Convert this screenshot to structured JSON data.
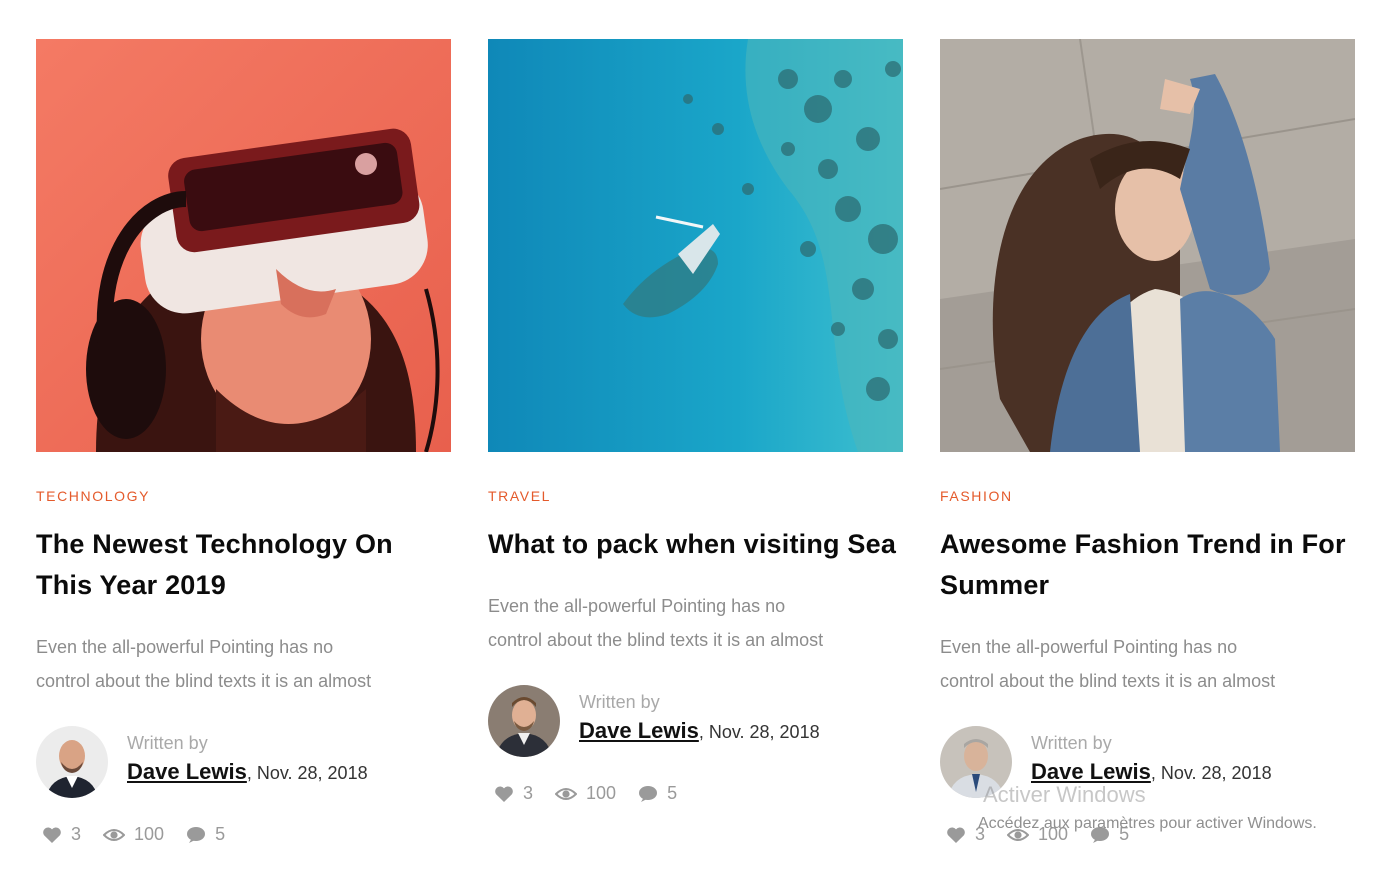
{
  "posts": [
    {
      "category": "TECHNOLOGY",
      "title": "The Newest Technology On This Year 2019",
      "excerpt_line1": "Even the all-powerful Pointing has no",
      "excerpt_line2": "control about the blind texts it is an almost",
      "written_by": "Written by",
      "author": "Dave Lewis",
      "date": ", Nov. 28, 2018",
      "likes": "3",
      "views": "100",
      "comments": "5",
      "image": "vr-headset-photo"
    },
    {
      "category": "TRAVEL",
      "title": "What to pack when visiting Sea",
      "excerpt_line1": "Even the all-powerful Pointing has no",
      "excerpt_line2": "control about the blind texts it is an almost",
      "written_by": "Written by",
      "author": "Dave Lewis",
      "date": ", Nov. 28, 2018",
      "likes": "3",
      "views": "100",
      "comments": "5",
      "image": "shipwreck-aerial-photo"
    },
    {
      "category": "FASHION",
      "title": "Awesome Fashion Trend in For Summer",
      "excerpt_line1": "Even the all-powerful Pointing has no",
      "excerpt_line2": "control about the blind texts it is an almost",
      "written_by": "Written by",
      "author": "Dave Lewis",
      "date": ", Nov. 28, 2018",
      "likes": "3",
      "views": "100",
      "comments": "5",
      "image": "denim-jacket-woman-photo"
    }
  ],
  "windows_watermark": {
    "title": "Activer Windows",
    "subtitle": "Accédez aux paramètres pour activer Windows."
  },
  "colors": {
    "category": "#e45a2b",
    "title": "#0b0b0b",
    "excerpt": "#8c8c8c",
    "icon": "#9a9a9a"
  },
  "icons": [
    "heart-icon",
    "eye-icon",
    "comment-icon"
  ]
}
